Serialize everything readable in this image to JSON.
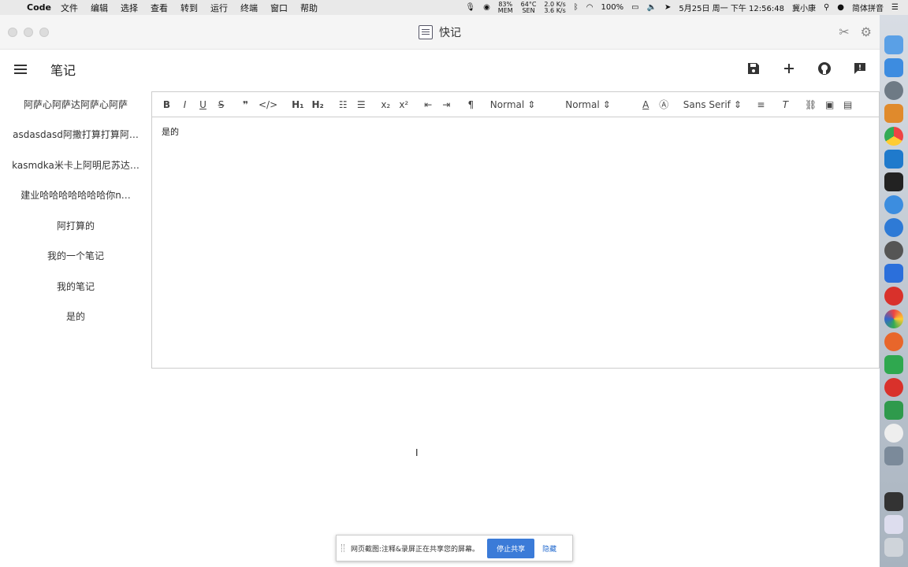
{
  "menubar": {
    "app_name": "Code",
    "menus": [
      "文件",
      "编辑",
      "选择",
      "查看",
      "转到",
      "运行",
      "终端",
      "窗口",
      "帮助"
    ],
    "mem": "83%",
    "mem_label": "MEM",
    "temp": "64°C",
    "temp_label": "SEN",
    "net_up": "2.0 K/s",
    "net_down": "3.6 K/s",
    "battery": "100%",
    "datetime": "5月25日 周一 下午 12:56:48",
    "user": "冀小康",
    "input_method": "简体拼音"
  },
  "window": {
    "title": "快记"
  },
  "appbar": {
    "title": "笔记"
  },
  "notes": [
    "阿萨心阿萨达阿萨心阿萨",
    "asdasdasd阿撒打算打算阿…",
    "kasmdka米卡上阿明尼苏达…",
    "建业哈哈哈哈哈哈哈你n…",
    "阿打算的",
    "我的一个笔记",
    "我的笔记",
    "是的"
  ],
  "toolbar": {
    "header_select": "Normal",
    "size_select": "Normal",
    "font_select": "Sans Serif"
  },
  "editor": {
    "content": "是的"
  },
  "share_bar": {
    "message": "网页截图:注释&录屏正在共享您的屏幕。",
    "stop_label": "停止共享",
    "hide_label": "隐藏"
  },
  "colors": {
    "accent": "#3b7bd8",
    "dock_background": "#c8d0da"
  }
}
